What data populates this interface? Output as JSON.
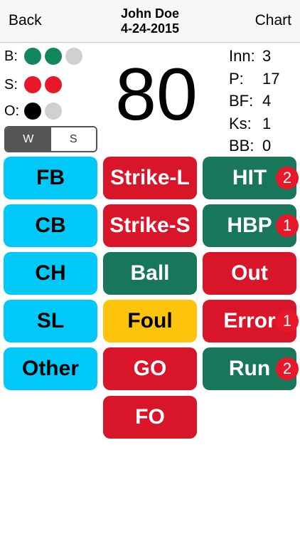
{
  "nav": {
    "back_label": "Back",
    "chart_label": "Chart",
    "player_name": "John Doe",
    "date": "4-24-2015"
  },
  "count": {
    "balls_label": "B:",
    "strikes_label": "S:",
    "outs_label": "O:",
    "colors": {
      "ball": "#12875a",
      "strike": "#e8182a",
      "out": "#000000",
      "empty": "#d0d0d0"
    }
  },
  "pitch_count": "80",
  "stats": {
    "inn_label": "Inn:",
    "inn_value": "3",
    "p_label": "P:",
    "p_value": "17",
    "bf_label": "BF:",
    "bf_value": "4",
    "ks_label": "Ks:",
    "ks_value": "1",
    "bb_label": "BB:",
    "bb_value": "0"
  },
  "segment": {
    "w_label": "W",
    "s_label": "S"
  },
  "pitch_types": {
    "fb": "FB",
    "cb": "CB",
    "ch": "CH",
    "sl": "SL",
    "other": "Other"
  },
  "results": {
    "strike_l": "Strike-L",
    "strike_s": "Strike-S",
    "ball": "Ball",
    "foul": "Foul",
    "go": "GO",
    "fo": "FO"
  },
  "outcomes": {
    "hit": "HIT",
    "hit_badge": "2",
    "hbp": "HBP",
    "hbp_badge": "1",
    "out": "Out",
    "error": "Error",
    "error_badge": "1",
    "run": "Run",
    "run_badge": "2"
  },
  "colors": {
    "cyan": "#00c8f8",
    "red": "#d9152a",
    "green": "#18775a",
    "yellow": "#fec30b"
  }
}
